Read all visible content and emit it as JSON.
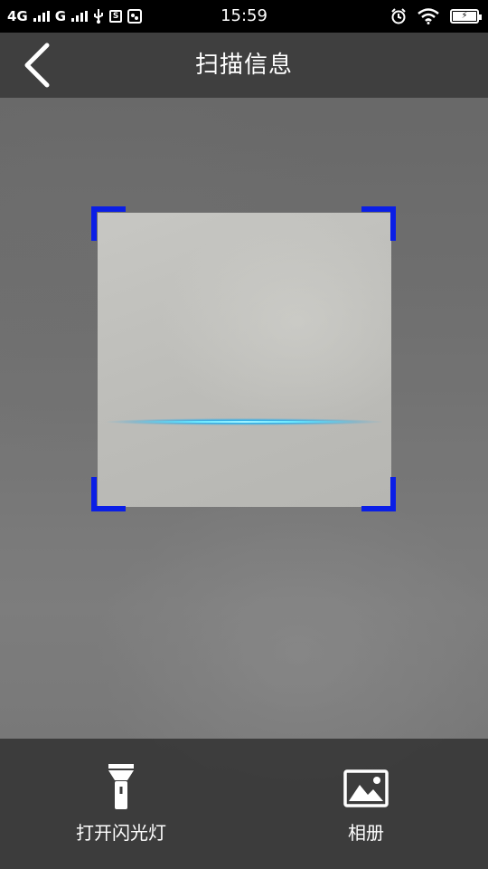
{
  "status_bar": {
    "network_1": "4G",
    "network_2": "G",
    "sim_icon_text": "S",
    "time": "15:59",
    "battery_symbol": "⚡"
  },
  "header": {
    "title": "扫描信息",
    "back_icon": "chevron-left-icon"
  },
  "scanner": {
    "frame_color": "#0a1ee6",
    "line_color": "#28d2ff"
  },
  "bottom_bar": {
    "flashlight_label": "打开闪光灯",
    "flashlight_icon": "flashlight-icon",
    "album_label": "相册",
    "album_icon": "image-icon"
  }
}
